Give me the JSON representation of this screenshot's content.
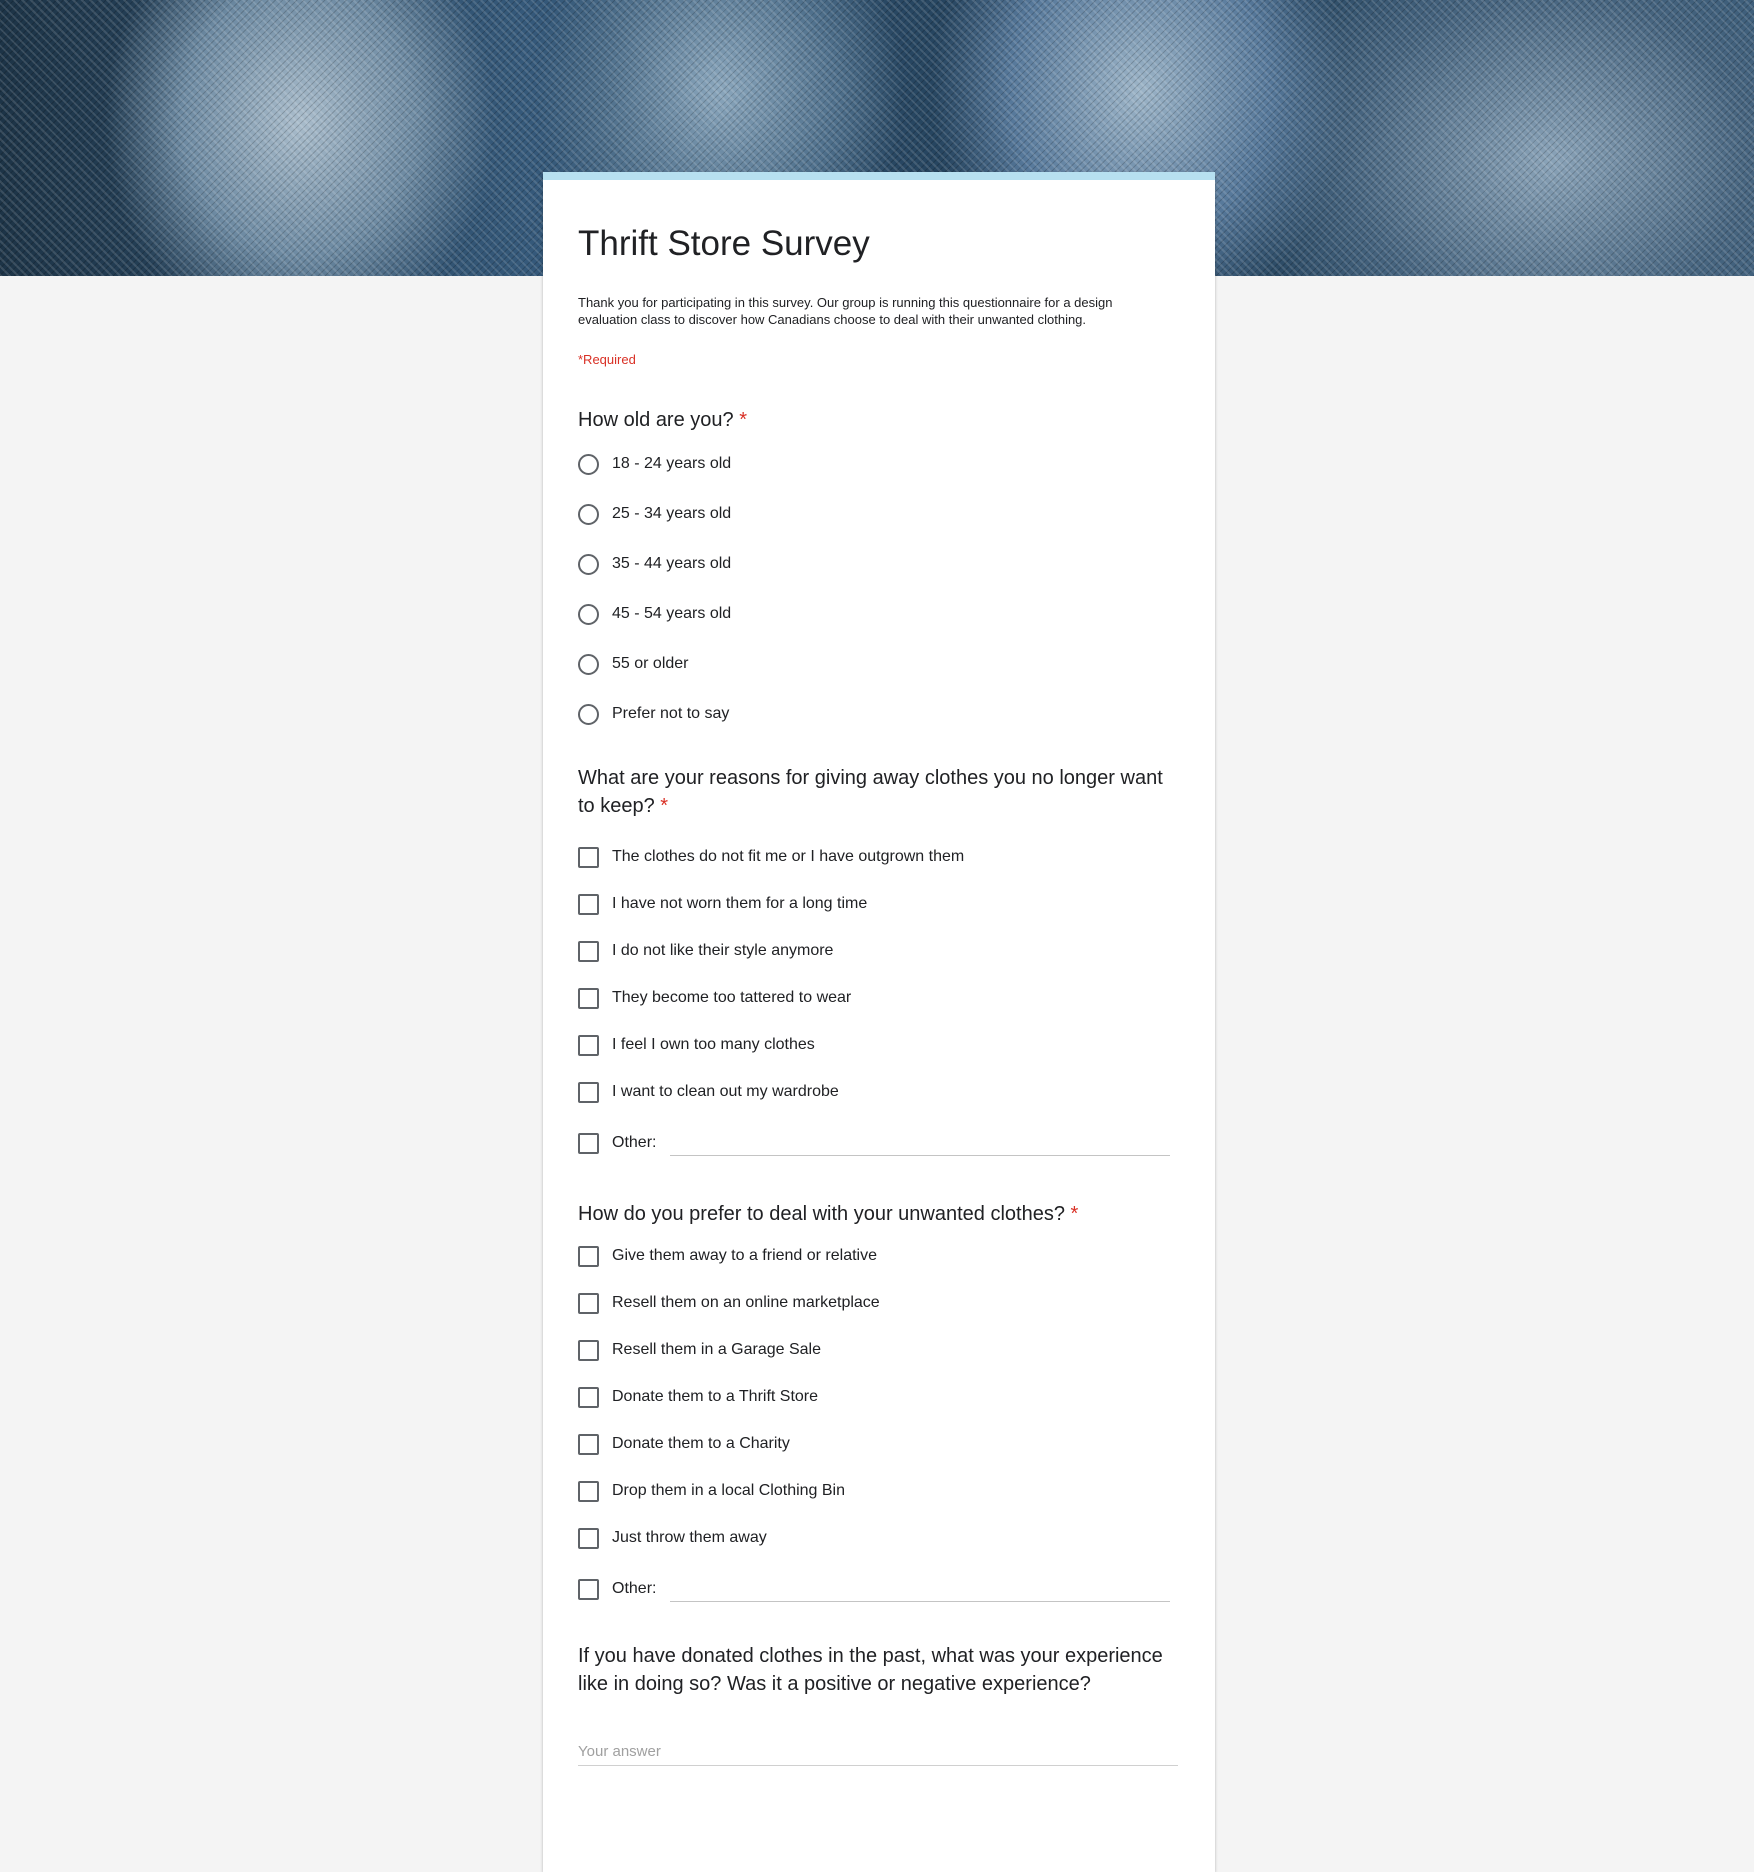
{
  "form": {
    "title": "Thrift Store Survey",
    "description": "Thank you for participating in this survey. Our group is running this questionnaire for a design evaluation class to discover how Canadians choose to deal with their unwanted clothing.",
    "required_note": "*Required"
  },
  "questions": [
    {
      "title": "How old are you?",
      "required_mark": "*",
      "type": "radio",
      "options": [
        "18 - 24 years old",
        "25 - 34 years old",
        "35 - 44 years old",
        "45 - 54 years old",
        "55 or older",
        "Prefer not to say"
      ]
    },
    {
      "title": "What are your reasons for giving away clothes you no longer want to keep?",
      "required_mark": "*",
      "type": "checkbox",
      "options": [
        "The clothes do not fit me or I have outgrown them",
        "I have not worn them for a long time",
        "I do not like their style anymore",
        "They become too tattered to wear",
        "I feel I own too many clothes",
        "I want to clean out my wardrobe",
        "Other:"
      ]
    },
    {
      "title": "How do you prefer to deal with your unwanted clothes?",
      "required_mark": "*",
      "type": "checkbox",
      "options": [
        "Give them away to a friend or relative",
        "Resell them on an online marketplace",
        "Resell them in a Garage Sale",
        "Donate them to a Thrift Store",
        "Donate them to a Charity",
        "Drop them in a local Clothing Bin",
        "Just throw them away",
        "Other:"
      ]
    },
    {
      "title": "If you have donated clothes in the past, what was your experience like in doing so? Was it a positive or negative experience?",
      "type": "text",
      "placeholder": "Your answer"
    }
  ],
  "theme": {
    "accent": "#b7e0f0",
    "required_color": "#d93025"
  }
}
